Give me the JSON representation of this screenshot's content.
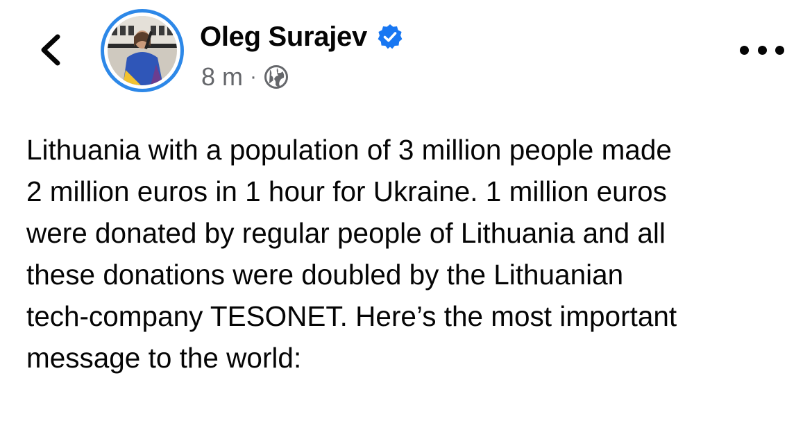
{
  "post": {
    "author": {
      "name": "Oleg Surajev",
      "verified": true
    },
    "timestamp": "8 m",
    "separator": "·",
    "privacy_icon": "globe-icon",
    "lines": [
      "Lithuania with a population of 3 million people made",
      "2 million euros in 1 hour for Ukraine. 1 million euros",
      "were donated by regular people of Lithuania and all",
      "these donations were doubled by the Lithuanian",
      "tech-company TESONET. Here’s the most important",
      "message to the world:"
    ]
  },
  "icons": {
    "back": "chevron-left-icon",
    "more": "more-horizontal-icon",
    "verified": "verified-badge-icon"
  },
  "colors": {
    "text": "#050505",
    "secondary_text": "#65676b",
    "verified_blue": "#1877f2",
    "avatar_ring": "#2d88e8"
  }
}
